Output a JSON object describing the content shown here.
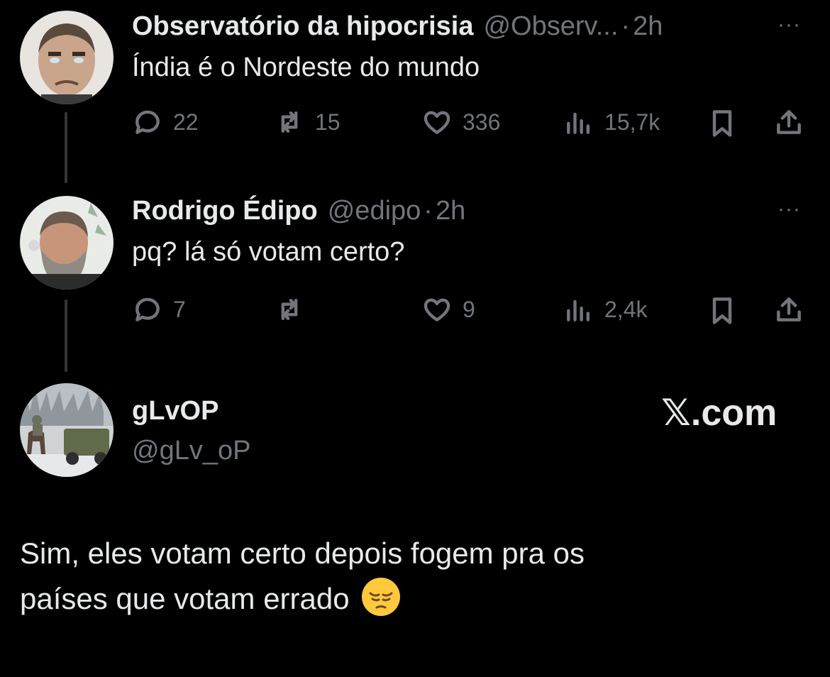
{
  "tweets": [
    {
      "name": "Observatório da hipocrisia",
      "handle": "@Observ...",
      "separator": "·",
      "time": "2h",
      "text": "Índia é o Nordeste do mundo",
      "more": "···",
      "replies": "22",
      "retweets": "15",
      "likes": "336",
      "views": "15,7k"
    },
    {
      "name": "Rodrigo Édipo",
      "handle": "@edipo",
      "separator": "·",
      "time": "2h",
      "text": "pq? lá só votam certo?",
      "more": "···",
      "replies": "7",
      "retweets": "",
      "likes": "9",
      "views": "2,4k"
    }
  ],
  "reply": {
    "name": "gLvOP",
    "handle": "@gLv_oP",
    "brand": "𝕏.com",
    "text_line1": "Sim, eles votam certo depois fogem pra os",
    "text_line2": "países que votam errado",
    "emoji": "pensive-face"
  },
  "colors": {
    "background": "#000000",
    "text": "#e7e9ea",
    "secondary": "#71767b",
    "thread_line": "#333639"
  }
}
